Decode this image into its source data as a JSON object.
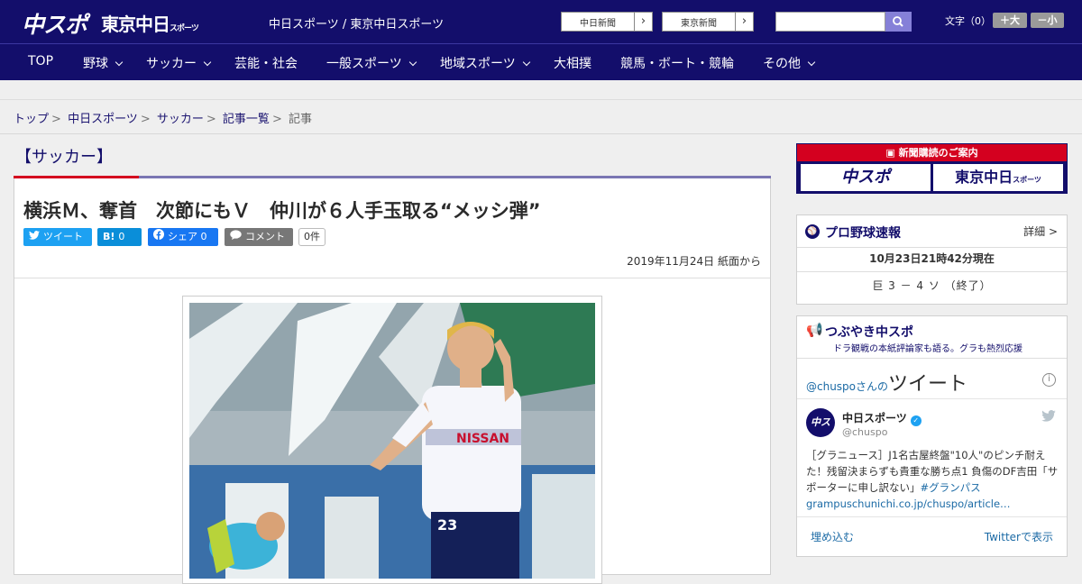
{
  "header": {
    "logo_chuspo": "中スポ",
    "logo_tokyo": "東京中日",
    "logo_tokyo_small": "スポーツ",
    "site_name": "中日スポーツ / 東京中日スポーツ",
    "ext_links": [
      {
        "label": "中日新聞",
        "arrow": "›"
      },
      {
        "label": "東京新聞",
        "arrow": "›"
      }
    ],
    "search_placeholder": "",
    "font_label": "文字（0）",
    "font_bigger": "＋大",
    "font_smaller": "－小"
  },
  "nav": [
    "TOP",
    "野球",
    "サッカー",
    "芸能・社会",
    "一般スポーツ",
    "地域スポーツ",
    "大相撲",
    "競馬・ボート・競輪",
    "その他"
  ],
  "breadcrumb": {
    "items": [
      "トップ",
      "中日スポーツ",
      "サッカー",
      "記事一覧"
    ],
    "current": "記事",
    "sep": ">"
  },
  "article": {
    "category": "【サッカー】",
    "title": "横浜Ｍ、奪首　次節にもＶ　仲川が６人手玉取る“メッシ弾”",
    "share": {
      "tweet": "ツイート",
      "hatena": "B!",
      "hatena_count": "0",
      "facebook": "シェア",
      "facebook_count": "0",
      "comment": "コメント",
      "comment_count": "0件"
    },
    "date": "2019年11月24日 紙面から"
  },
  "sidebar": {
    "ad": {
      "header": "新聞購読のご案内",
      "chuspo": "中スポ",
      "tokyo": "東京中日",
      "tokyo_small": "スポーツ"
    },
    "baseball": {
      "title": "プロ野球速報",
      "more": "詳細 >",
      "updated": "10月23日21時42分現在",
      "score": "巨 3 － 4 ソ （終了）"
    },
    "tsubuyaki": {
      "title": "つぶやき中スポ",
      "subtitle": "ドラ観戦の本紙評論家も語る。グラも熱烈応援",
      "tweets_header_user": "@chuspoさんの",
      "tweets_header_word": "ツイート",
      "info": "i",
      "avatar_text": "中スポ",
      "name": "中日スポーツ",
      "verified": "✓",
      "handle": "@chuspo",
      "text": "［グラニュース］J1名古屋終盤\"10人\"のピンチ耐えた！残留決まらずも貴重な勝ち点1 負傷のDF吉田「サポーターに申し訳ない」",
      "hashtag": "#グランパス",
      "link": "grampuschunichi.co.jp/chuspo/article…",
      "embed": "埋め込む",
      "view": "Twitterで表示"
    }
  }
}
